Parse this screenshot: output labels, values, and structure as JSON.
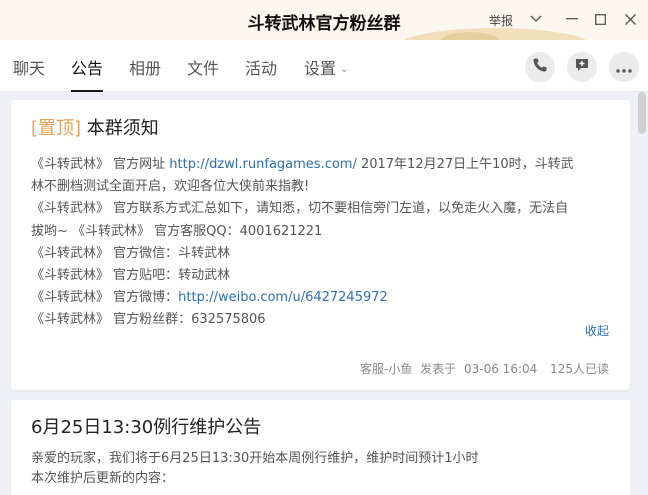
{
  "window": {
    "title": "斗转武林官方粉丝群",
    "report_label": "举报"
  },
  "tabs": [
    {
      "label": "聊天"
    },
    {
      "label": "公告",
      "active": true
    },
    {
      "label": "相册"
    },
    {
      "label": "文件"
    },
    {
      "label": "活动"
    },
    {
      "label": "设置"
    }
  ],
  "actions": {
    "call_icon": "phone-icon",
    "notice_icon": "add-notice-icon",
    "more_icon": "more-icon"
  },
  "announcements": [
    {
      "pin_label": "[置顶]",
      "title": "本群须知",
      "lines": [
        {
          "pre": "《斗转武林》 官方网址 ",
          "link": "http://dzwl.runfagames.com/",
          "post": " 2017年12月27日上午10时，斗转武"
        },
        {
          "pre": "林不删档测试全面开启，欢迎各位大侠前来指教!",
          "link": "",
          "post": ""
        },
        {
          "pre": "《斗转武林》 官方联系方式汇总如下，请知悉，切不要相信旁门左道，以免走火入魔，无法自",
          "link": "",
          "post": ""
        },
        {
          "pre": "拔哟~ 《斗转武林》 官方客服QQ：4001621221",
          "link": "",
          "post": ""
        },
        {
          "pre": "《斗转武林》 官方微信：斗转武林",
          "link": "",
          "post": ""
        },
        {
          "pre": "《斗转武林》 官方贴吧：转动武林",
          "link": "",
          "post": ""
        },
        {
          "pre": "《斗转武林》 官方微博：",
          "link": "http://weibo.com/u/6427245972",
          "post": ""
        },
        {
          "pre": "《斗转武林》 官方粉丝群：632575806",
          "link": "",
          "post": ""
        }
      ],
      "collapse_label": "收起",
      "author": "客服-小鱼",
      "posted_prefix": "发表于",
      "date": "03-06 16:04",
      "read_count": "125人已读"
    },
    {
      "title": "6月25日13:30例行维护公告",
      "lines": [
        {
          "pre": "亲爱的玩家，我们将于6月25日13:30开始本周例行维护，维护时间预计1小时",
          "link": "",
          "post": ""
        },
        {
          "pre": "本次维护后更新的内容：",
          "link": "",
          "post": ""
        }
      ]
    }
  ],
  "colors": {
    "accent_pin": "#e8a35a",
    "link": "#2d6fb3",
    "background": "#eef0f5"
  }
}
